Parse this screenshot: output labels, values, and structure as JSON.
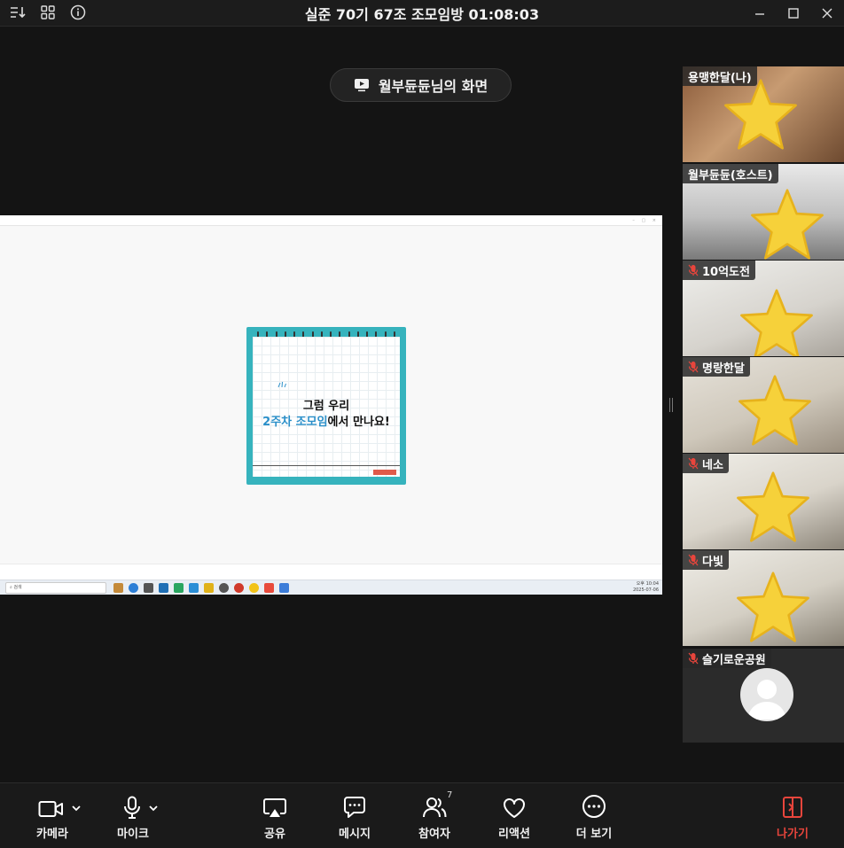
{
  "window": {
    "title": "실준 70기 67조 조모임방 01:08:03"
  },
  "share": {
    "label": "월부듄듄님의 화면"
  },
  "shared_screen": {
    "note_line1": "그럼 우리",
    "note_line2_highlight": "2주차 조모임",
    "note_line2_rest": "에서 만나요!",
    "taskbar_search": "검색",
    "clock_time": "오후 10:04",
    "clock_date": "2025-07-06"
  },
  "participants": [
    {
      "name": "용맹한달(나)",
      "muted": false
    },
    {
      "name": "월부듄듄(호스트)",
      "muted": false
    },
    {
      "name": "10억도전",
      "muted": true
    },
    {
      "name": "명랑한달",
      "muted": true
    },
    {
      "name": "네소",
      "muted": true
    },
    {
      "name": "다빛",
      "muted": true
    },
    {
      "name": "슬기로운공원",
      "muted": true
    }
  ],
  "toolbar": {
    "camera": "카메라",
    "mic": "마이크",
    "share": "공유",
    "message": "메시지",
    "participants": "참여자",
    "participants_count": "7",
    "reaction": "리액션",
    "more": "더 보기",
    "leave": "나가기"
  },
  "colors": {
    "leave": "#e8453c",
    "note_frame": "#36b3bd",
    "highlight_text": "#2a8fc9"
  }
}
